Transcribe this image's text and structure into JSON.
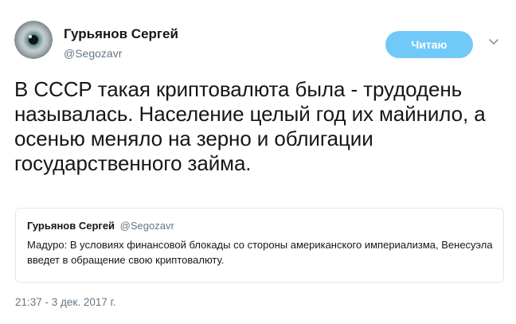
{
  "author": {
    "name": "Гурьянов Сергей",
    "handle": "@Segozavr"
  },
  "follow_button": {
    "label": "Читаю",
    "color": "#71c9f8"
  },
  "tweet": {
    "text": "В СССР такая криптовалюта была - трудодень называлась. Население целый год их майнило, а осенью меняло на зерно и облигации государственного займа.",
    "timestamp": "21:37 - 3 дек. 2017 г."
  },
  "quoted_tweet": {
    "name": "Гурьянов Сергей",
    "handle": "@Segozavr",
    "text": "Мадуро: В условиях финансовой блокады со стороны американского империализма, Венесуэла введет в обращение свою криптовалюту."
  },
  "icons": {
    "avatar": "eye-avatar",
    "caret": "chevron-down-icon"
  }
}
